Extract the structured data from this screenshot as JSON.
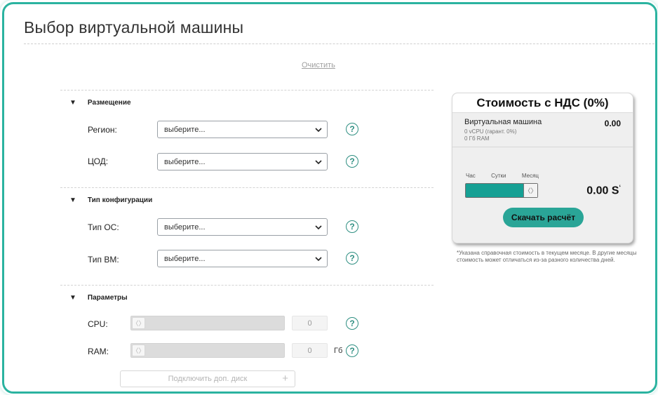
{
  "page": {
    "title": "Выбор виртуальной машины",
    "clear_label": "Очистить",
    "accent_color": "#2bb3a0"
  },
  "sections": {
    "placement": {
      "title": "Размещение",
      "region": {
        "label": "Регион:",
        "value": "выберите..."
      },
      "dc": {
        "label": "ЦОД:",
        "value": "выберите..."
      }
    },
    "config_type": {
      "title": "Тип конфигурации",
      "os": {
        "label": "Тип ОС:",
        "value": "выберите..."
      },
      "vm": {
        "label": "Тип ВМ:",
        "value": "выберите..."
      }
    },
    "params": {
      "title": "Параметры",
      "cpu": {
        "label": "CPU:",
        "value": "0"
      },
      "ram": {
        "label": "RAM:",
        "value": "0",
        "unit": "Гб"
      },
      "add_disk_label": "Подключить доп. диск"
    }
  },
  "help_glyph": "?",
  "slider_handle_glyph": "〈〉",
  "cost": {
    "header": "Стоимость с НДС (0%)",
    "item": {
      "name": "Виртуальная машина",
      "value": "0.00",
      "sub_cpu": "0 vCPU (гарант. 0%)",
      "sub_ram": "0 Гб RAM"
    },
    "periods": [
      "Час",
      "Сутки",
      "Месяц"
    ],
    "selected_period": "Месяц",
    "total": "0.00 S",
    "total_sup": "‘",
    "download_label": "Скачать расчёт",
    "footnote": "*Указана справочная стоимость в текущем месяце. В другие месяцы стоимость может отличаться из-за разного количества дней.",
    "slider_color": "#16a094",
    "button_color": "#2aa597"
  }
}
